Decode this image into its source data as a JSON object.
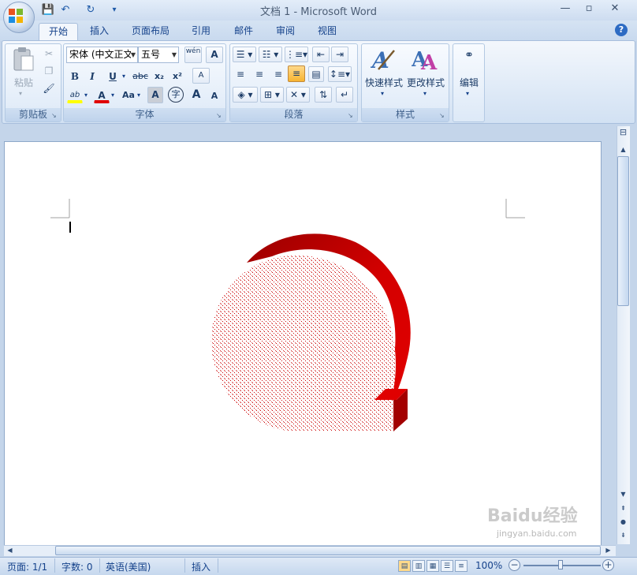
{
  "window": {
    "title": "文档 1 - Microsoft Word",
    "controls": {
      "minimize": "—",
      "maximize": "▫",
      "close": "✕"
    }
  },
  "quick_access": {
    "save": "💾",
    "undo": "↶",
    "redo": "↻",
    "customize": "▾"
  },
  "tabs": [
    "开始",
    "插入",
    "页面布局",
    "引用",
    "邮件",
    "审阅",
    "视图"
  ],
  "help": "?",
  "ribbon": {
    "clipboard": {
      "label": "剪贴板",
      "paste": "粘贴",
      "cut_icon": "✂",
      "copy_icon": "❐",
      "format_painter_icon": "🖌"
    },
    "font": {
      "label": "字体",
      "font_name": "宋体 (中文正文)",
      "font_size": "五号",
      "pinyin_icon": "wén",
      "border_char_icon": "A",
      "bold": "B",
      "italic": "I",
      "underline": "U",
      "strike": "abc",
      "subscript": "x₂",
      "superscript": "x²",
      "clear": "A",
      "highlight": "ab",
      "font_color": "A",
      "change_case": "Aa",
      "char_shading": "A",
      "enclose": "字",
      "grow": "A",
      "shrink": "A"
    },
    "paragraph": {
      "label": "段落"
    },
    "styles": {
      "label": "样式",
      "quick_styles": "快速样式",
      "change_styles": "更改样式"
    },
    "editing": {
      "label": "编辑"
    }
  },
  "colors": {
    "shape_red": "#cc0000",
    "shape_dark_red": "#7a0000",
    "highlight_yellow": "#ffff00",
    "font_red": "#e00000",
    "accent_blue": "#15428b"
  },
  "status": {
    "page": "页面: 1/1",
    "words": "字数: 0",
    "language": "英语(美国)",
    "mode": "插入",
    "zoom": "100%",
    "zoom_out": "−",
    "zoom_in": "+"
  },
  "watermark": {
    "main": "Baidu经验",
    "sub": "jingyan.baidu.com"
  }
}
